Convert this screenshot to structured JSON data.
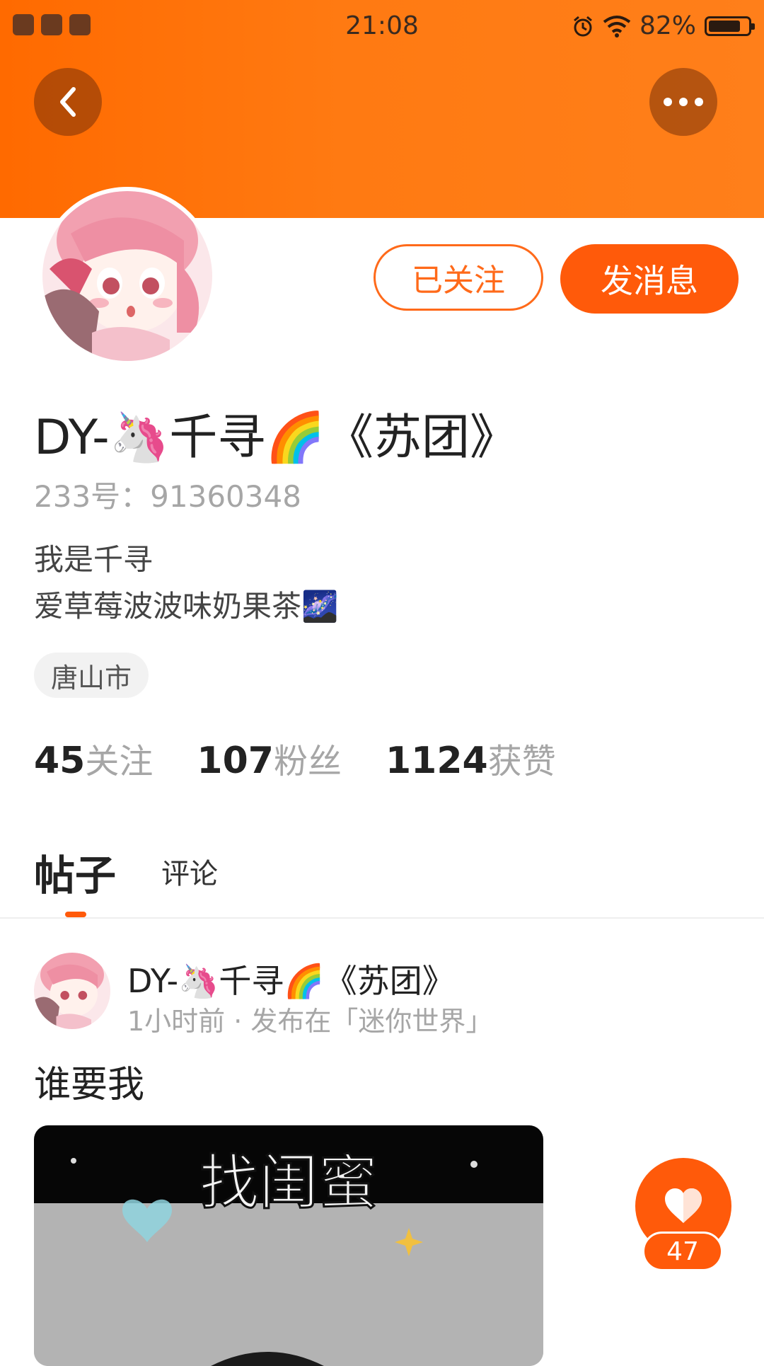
{
  "status_bar": {
    "time": "21:08",
    "battery": "82%",
    "battery_level": 0.82
  },
  "header": {
    "back_icon": "chevron-left-icon",
    "more_icon": "more-dots-icon"
  },
  "profile": {
    "follow_label": "已关注",
    "message_label": "发消息",
    "name": "DY-🦄千寻🌈《苏团》",
    "uid": "233号：91360348",
    "bio_line1": "我是千寻",
    "bio_line2": "爱草莓波波味奶果茶🌌",
    "location": "唐山市",
    "stats": [
      {
        "num": "45",
        "label": "关注"
      },
      {
        "num": "107",
        "label": "粉丝"
      },
      {
        "num": "1124",
        "label": "获赞"
      }
    ]
  },
  "tabs": {
    "posts": "帖子",
    "comments": "评论"
  },
  "post": {
    "author": "DY-🦄千寻🌈《苏团》",
    "meta": "1小时前 · 发布在「迷你世界」",
    "text": "谁要我",
    "image_caption": "找闺蜜",
    "like_count": "47"
  },
  "colors": {
    "accent": "#ff5a0a",
    "header": "#ff7a12"
  }
}
